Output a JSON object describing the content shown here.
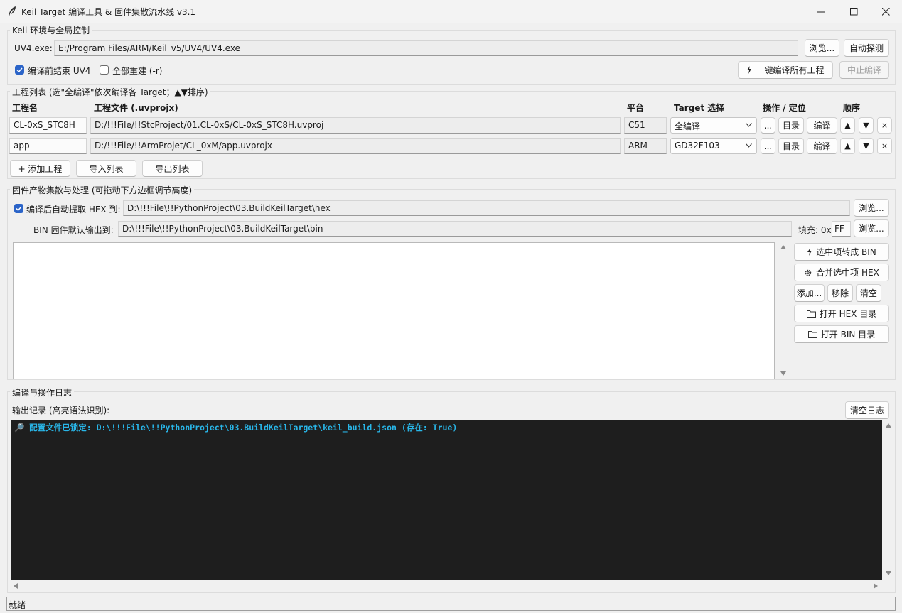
{
  "window": {
    "title": "Keil Target 编译工具 & 固件集散流水线  v3.1",
    "app_icon": "feather-icon",
    "controls": [
      "minimize-icon",
      "maximize-icon",
      "close-icon"
    ]
  },
  "keil": {
    "group_title": "Keil 环境与全局控制",
    "uv4_label": "UV4.exe:",
    "uv4_path": "E:/Program Files/ARM/Keil_v5/UV4/UV4.exe",
    "browse_label": "浏览...",
    "detect_label": "自动探测",
    "close_uv4_label": "编译前结束 UV4",
    "close_uv4_checked": true,
    "rebuild_label": "全部重建 (-r)",
    "rebuild_checked": false,
    "build_all_label": "一键编译所有工程",
    "stop_label": "中止编译"
  },
  "projects": {
    "group_title": "工程列表 (选\"全编译\"依次编译各 Target；▲▼排序)",
    "headers": {
      "name": "工程名",
      "file": "工程文件 (.uvprojx)",
      "platform": "平台",
      "target": "Target 选择",
      "ops": "操作 / 定位",
      "order": "顺序"
    },
    "rows": [
      {
        "name": "CL-0xS_STC8H",
        "file": "D:/!!!File/!!StcProject/01.CL-0xS/CL-0xS_STC8H.uvproj",
        "platform": "C51",
        "target": "全编译"
      },
      {
        "name": "app",
        "file": "D:/!!!File/!!ArmProjet/CL_0xM/app.uvprojx",
        "platform": "ARM",
        "target": "GD32F103"
      }
    ],
    "row_buttons": {
      "more": "...",
      "dir": "目录",
      "build": "编译",
      "up": "▲",
      "down": "▼",
      "remove": "×"
    },
    "add_label": "+ 添加工程",
    "import_label": "导入列表",
    "export_label": "导出列表"
  },
  "firmware": {
    "group_title": "固件产物集散与处理 (可拖动下方边框调节高度)",
    "hex_label": "编译后自动提取 HEX 到:",
    "hex_checked": true,
    "hex_path": "D:\\!!!File\\!!PythonProject\\03.BuildKeilTarget\\hex",
    "bin_label": "BIN 固件默认输出到:",
    "bin_path": "D:\\!!!File\\!!PythonProject\\03.BuildKeilTarget\\bin",
    "fill_label": "填充: 0x",
    "fill_value": "FF",
    "browse_label": "浏览...",
    "to_bin_label": "选中项转成 BIN",
    "merge_hex_label": "合并选中项 HEX",
    "add_label": "添加...",
    "remove_label": "移除",
    "clear_label": "清空",
    "open_hex_dir_label": "打开 HEX 目录",
    "open_bin_dir_label": "打开 BIN 目录"
  },
  "log": {
    "group_title": "编译与操作日志",
    "output_label": "输出记录 (高亮语法识别):",
    "clear_label": "清空日志",
    "lines": [
      "🔎 配置文件已锁定: D:\\!!!File\\!!PythonProject\\03.BuildKeilTarget\\keil_build.json (存在: True)"
    ],
    "line_color": "#29b6e8"
  },
  "status": {
    "text": "就绪"
  },
  "colors": {
    "accent": "#2b64c8",
    "log_bg": "#1e1e1e",
    "log_text": "#29b6e8"
  }
}
